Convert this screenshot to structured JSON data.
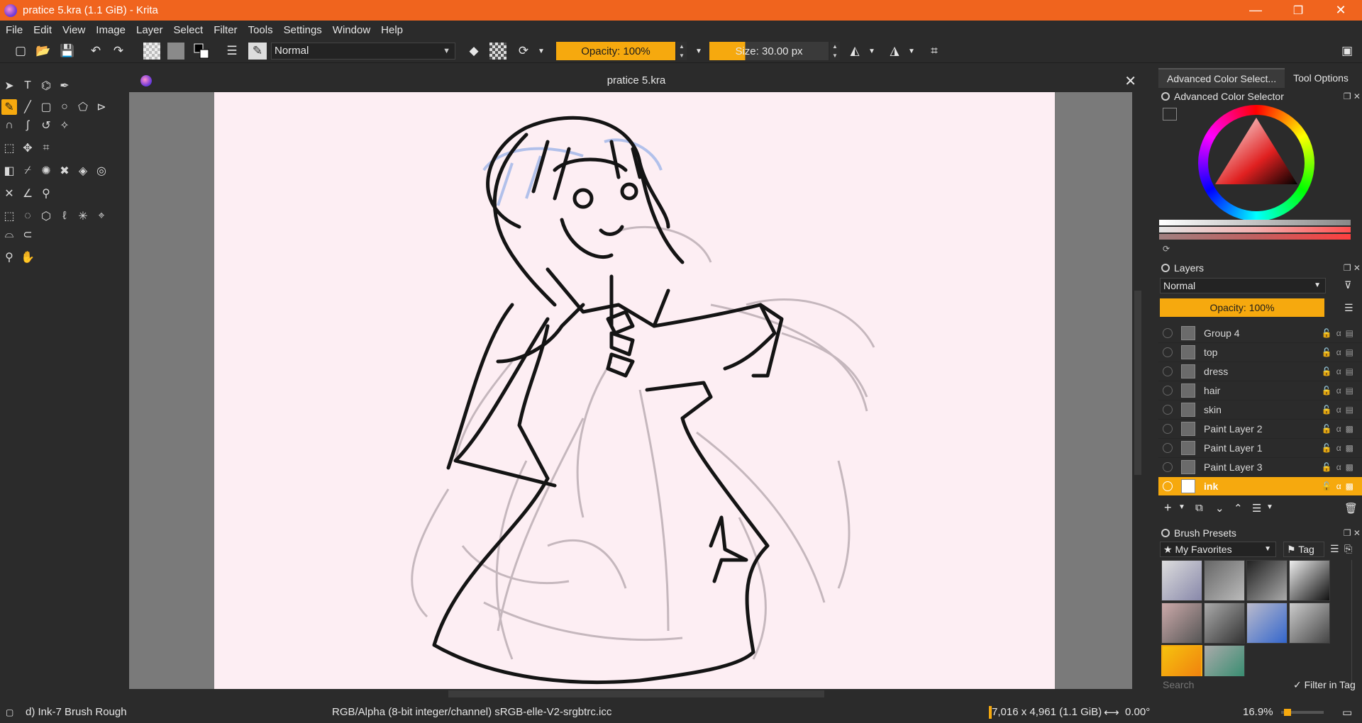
{
  "window": {
    "title": "pratice 5.kra (1.1 GiB)  - Krita",
    "minimize": "—",
    "maximize": "❐",
    "close": "✕"
  },
  "menu": [
    "File",
    "Edit",
    "View",
    "Image",
    "Layer",
    "Select",
    "Filter",
    "Tools",
    "Settings",
    "Window",
    "Help"
  ],
  "toolbar": {
    "blend_mode": "Normal",
    "opacity_label": "Opacity: 100%",
    "size_label": "Size: 30.00 px"
  },
  "document": {
    "tab_title": "pratice 5.kra",
    "close": "✕"
  },
  "dock": {
    "tabs": [
      "Advanced Color Select...",
      "Tool Options"
    ],
    "color_selector_title": "Advanced Color Selector",
    "layers": {
      "title": "Layers",
      "blend_mode": "Normal",
      "opacity_label": "Opacity:  100%",
      "items": [
        {
          "name": "Group 4",
          "type": "group",
          "active": false
        },
        {
          "name": "top",
          "type": "group",
          "active": false
        },
        {
          "name": "dress",
          "type": "group",
          "active": false
        },
        {
          "name": "hair",
          "type": "group",
          "active": false
        },
        {
          "name": "skin",
          "type": "group",
          "active": false
        },
        {
          "name": "Paint Layer 2",
          "type": "paint",
          "active": false
        },
        {
          "name": "Paint Layer 1",
          "type": "paint",
          "active": false
        },
        {
          "name": "Paint Layer 3",
          "type": "paint",
          "active": false
        },
        {
          "name": "ink",
          "type": "paint",
          "active": true
        }
      ]
    },
    "brush_presets": {
      "title": "Brush Presets",
      "tag_filter": "My Favorites",
      "tag_button": "Tag",
      "search_placeholder": "Search",
      "filter_in_tag": "Filter in Tag"
    }
  },
  "status": {
    "brush": "d) Ink-7 Brush Rough",
    "color_space": "RGB/Alpha (8-bit integer/channel)  sRGB-elle-V2-srgbtrc.icc",
    "dimensions": "7,016 x 4,961 (1.1 GiB)",
    "rotation": "0.00°",
    "zoom": "16.9%"
  },
  "colors": {
    "accent": "#f6a90e",
    "titlebar": "#f0641e",
    "paper": "#fdeef3",
    "panel": "#2b2b2b"
  }
}
